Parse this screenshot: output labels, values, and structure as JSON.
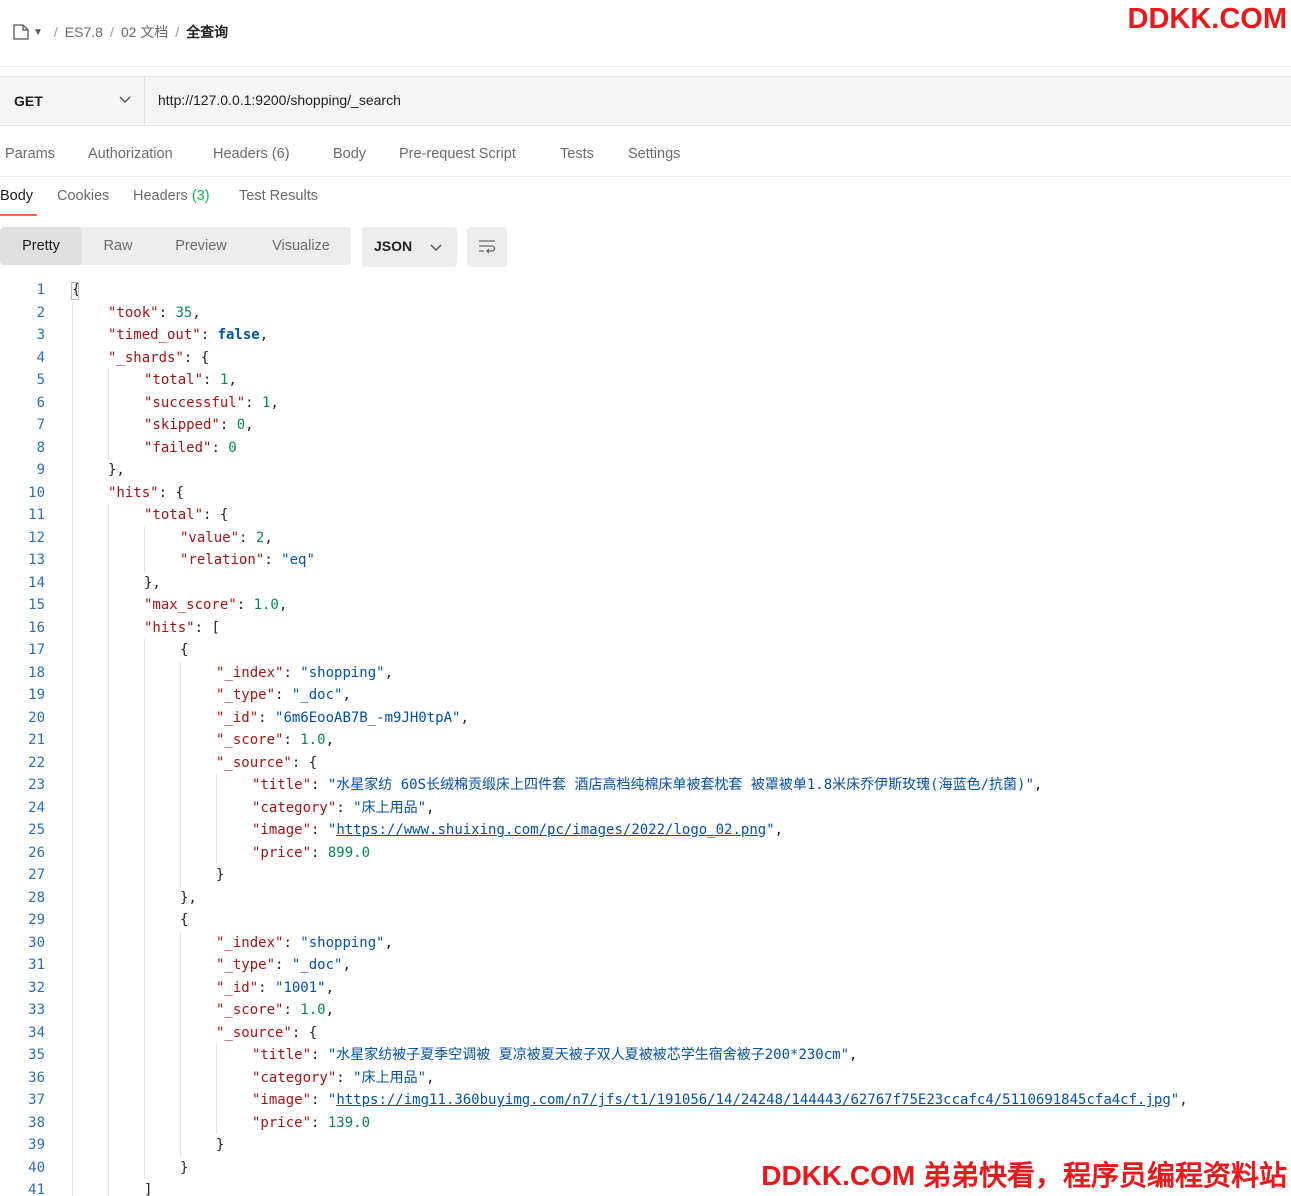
{
  "breadcrumb": {
    "icon": "document-icon",
    "items": [
      "ES7.8",
      "02 文档",
      "全查询"
    ]
  },
  "watermark_top": "DDKK.COM",
  "watermark_bottom": "DDKK.COM 弟弟快看，程序员编程资料站",
  "request": {
    "method": "GET",
    "url": "http://127.0.0.1:9200/shopping/_search"
  },
  "request_tabs": [
    {
      "label": "Params"
    },
    {
      "label": "Authorization"
    },
    {
      "label": "Headers",
      "count": "(6)"
    },
    {
      "label": "Body"
    },
    {
      "label": "Pre-request Script"
    },
    {
      "label": "Tests"
    },
    {
      "label": "Settings"
    }
  ],
  "response_tabs": [
    {
      "label": "Body",
      "active": true
    },
    {
      "label": "Cookies"
    },
    {
      "label": "Headers",
      "count": "(3)"
    },
    {
      "label": "Test Results"
    }
  ],
  "view_modes": [
    "Pretty",
    "Raw",
    "Preview",
    "Visualize"
  ],
  "selected_view": "Pretty",
  "format": "JSON",
  "colors": {
    "accent": "#ff6c37",
    "key": "#a31515",
    "string": "#0451a5",
    "number": "#098658",
    "count_green": "#0cbb52"
  },
  "code_lines": [
    {
      "indent": 0,
      "text": "{"
    },
    {
      "indent": 1,
      "key": "took",
      "val": "35",
      "vtype": "n",
      "trail": ","
    },
    {
      "indent": 1,
      "key": "timed_out",
      "val": "false",
      "vtype": "b",
      "trail": ","
    },
    {
      "indent": 1,
      "key": "_shards",
      "open": "{"
    },
    {
      "indent": 2,
      "key": "total",
      "val": "1",
      "vtype": "n",
      "trail": ","
    },
    {
      "indent": 2,
      "key": "successful",
      "val": "1",
      "vtype": "n",
      "trail": ","
    },
    {
      "indent": 2,
      "key": "skipped",
      "val": "0",
      "vtype": "n",
      "trail": ","
    },
    {
      "indent": 2,
      "key": "failed",
      "val": "0",
      "vtype": "n",
      "trail": ""
    },
    {
      "indent": 1,
      "text": "},"
    },
    {
      "indent": 1,
      "key": "hits",
      "open": "{"
    },
    {
      "indent": 2,
      "key": "total",
      "open": "{"
    },
    {
      "indent": 3,
      "key": "value",
      "val": "2",
      "vtype": "n",
      "trail": ","
    },
    {
      "indent": 3,
      "key": "relation",
      "val": "\"eq\"",
      "vtype": "s",
      "trail": ""
    },
    {
      "indent": 2,
      "text": "},"
    },
    {
      "indent": 2,
      "key": "max_score",
      "val": "1.0",
      "vtype": "n",
      "trail": ","
    },
    {
      "indent": 2,
      "key": "hits",
      "open": "["
    },
    {
      "indent": 3,
      "text": "{"
    },
    {
      "indent": 4,
      "key": "_index",
      "val": "\"shopping\"",
      "vtype": "s",
      "trail": ","
    },
    {
      "indent": 4,
      "key": "_type",
      "val": "\"_doc\"",
      "vtype": "s",
      "trail": ","
    },
    {
      "indent": 4,
      "key": "_id",
      "val": "\"6m6EooAB7B_-m9JH0tpA\"",
      "vtype": "s",
      "trail": ","
    },
    {
      "indent": 4,
      "key": "_score",
      "val": "1.0",
      "vtype": "n",
      "trail": ","
    },
    {
      "indent": 4,
      "key": "_source",
      "open": "{"
    },
    {
      "indent": 5,
      "key": "title",
      "val": "\"水星家纺 60S长绒棉贡缎床上四件套 酒店高档纯棉床单被套枕套 被罩被单1.8米床乔伊斯玫瑰(海蓝色/抗菌)\"",
      "vtype": "s",
      "trail": ","
    },
    {
      "indent": 5,
      "key": "category",
      "val": "\"床上用品\"",
      "vtype": "s",
      "trail": ","
    },
    {
      "indent": 5,
      "key": "image",
      "val": "https://www.shuixing.com/pc/images/2022/logo_02.png",
      "vtype": "u",
      "trail": ","
    },
    {
      "indent": 5,
      "key": "price",
      "val": "899.0",
      "vtype": "n",
      "trail": ""
    },
    {
      "indent": 4,
      "text": "}"
    },
    {
      "indent": 3,
      "text": "},"
    },
    {
      "indent": 3,
      "text": "{"
    },
    {
      "indent": 4,
      "key": "_index",
      "val": "\"shopping\"",
      "vtype": "s",
      "trail": ","
    },
    {
      "indent": 4,
      "key": "_type",
      "val": "\"_doc\"",
      "vtype": "s",
      "trail": ","
    },
    {
      "indent": 4,
      "key": "_id",
      "val": "\"1001\"",
      "vtype": "s",
      "trail": ","
    },
    {
      "indent": 4,
      "key": "_score",
      "val": "1.0",
      "vtype": "n",
      "trail": ","
    },
    {
      "indent": 4,
      "key": "_source",
      "open": "{"
    },
    {
      "indent": 5,
      "key": "title",
      "val": "\"水星家纺被子夏季空调被 夏凉被夏天被子双人夏被被芯学生宿舍被子200*230cm\"",
      "vtype": "s",
      "trail": ","
    },
    {
      "indent": 5,
      "key": "category",
      "val": "\"床上用品\"",
      "vtype": "s",
      "trail": ","
    },
    {
      "indent": 5,
      "key": "image",
      "val": "https://img11.360buyimg.com/n7/jfs/t1/191056/14/24248/144443/62767f75E23ccafc4/5110691845cfa4cf.jpg",
      "vtype": "u",
      "trail": ","
    },
    {
      "indent": 5,
      "key": "price",
      "val": "139.0",
      "vtype": "n",
      "trail": ""
    },
    {
      "indent": 4,
      "text": "}"
    },
    {
      "indent": 3,
      "text": "}"
    },
    {
      "indent": 2,
      "text": "]"
    }
  ]
}
